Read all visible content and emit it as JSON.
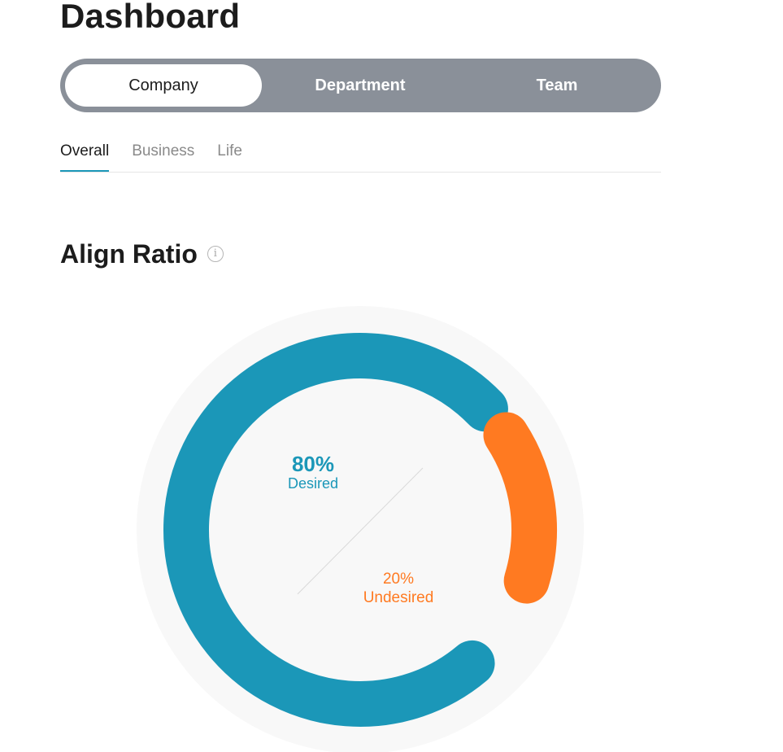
{
  "page": {
    "title": "Dashboard"
  },
  "scope_switch": {
    "options": [
      {
        "label": "Company",
        "active": true
      },
      {
        "label": "Department",
        "active": false
      },
      {
        "label": "Team",
        "active": false
      }
    ]
  },
  "subtabs": [
    {
      "label": "Overall",
      "active": true
    },
    {
      "label": "Business",
      "active": false
    },
    {
      "label": "Life",
      "active": false
    }
  ],
  "align_ratio": {
    "title": "Align Ratio",
    "info_icon": "info-icon"
  },
  "chart_data": {
    "type": "pie",
    "variant": "donut",
    "slices": [
      {
        "label": "Desired",
        "value": 80,
        "display": "80%",
        "color": "#1b97b8"
      },
      {
        "label": "Undesired",
        "value": 20,
        "display": "20%",
        "color": "#ff7a21"
      }
    ]
  },
  "colors": {
    "accent": "#1b97b8",
    "secondary": "#ff7a21",
    "switch_bg": "#8a9099"
  }
}
